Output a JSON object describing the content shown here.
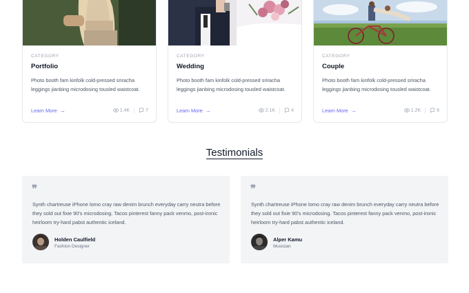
{
  "cards": [
    {
      "category": "CATEGORY",
      "title": "Portfolio",
      "description": "Photo booth fam kinfolk cold-pressed sriracha leggings jianbing microdosing tousled waistcoat.",
      "link": "Learn More",
      "views": "1.4K",
      "comments": "7",
      "photo": "woman-portrait-photo"
    },
    {
      "category": "CATEGORY",
      "title": "Wedding",
      "description": "Photo booth fam kinfolk cold-pressed sriracha leggings jianbing microdosing tousled waistcoat.",
      "link": "Learn More",
      "views": "2.1K",
      "comments": "4",
      "photo": "wedding-couple-photo"
    },
    {
      "category": "CATEGORY",
      "title": "Couple",
      "description": "Photo booth fam kinfolk cold-pressed sriracha leggings jianbing microdosing tousled waistcoat.",
      "link": "Learn More",
      "views": "1.2K",
      "comments": "6",
      "photo": "couple-bicycle-photo"
    }
  ],
  "testimonials_heading": "Testimonials",
  "testimonials": [
    {
      "text": "Synth chartreuse iPhone lomo cray raw denim brunch everyday carry neutra before they sold out fixie 90's microdosing. Tacos pinterest fanny pack venmo, post-ironic heirloom try-hard pabst authentic iceland.",
      "name": "Holden Caulfield",
      "role": "Fashion Designer"
    },
    {
      "text": "Synth chartreuse iPhone lomo cray raw denim brunch everyday carry neutra before they sold out fixie 90's microdosing. Tacos pinterest fanny pack venmo, post-ironic heirloom try-hard pabst authentic iceland.",
      "name": "Alper Kamu",
      "role": "Musician"
    }
  ],
  "colors": {
    "accent": "#6366f1",
    "muted": "#9ca3af",
    "card_bg": "#f3f4f6"
  }
}
